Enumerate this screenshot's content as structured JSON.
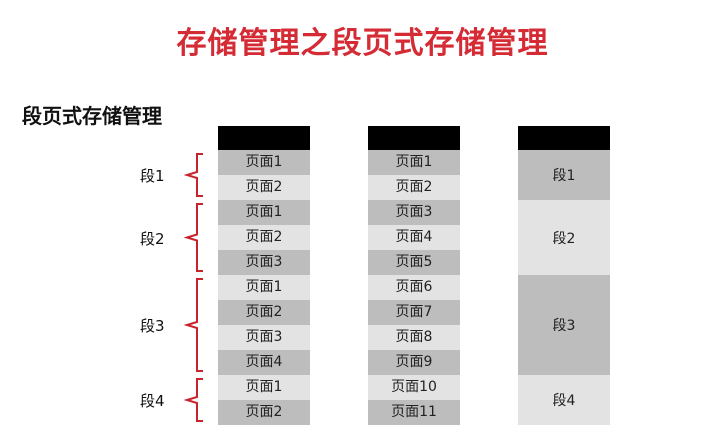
{
  "title": "存储管理之段页式存储管理",
  "subtitle": "段页式存储管理",
  "segments": [
    {
      "label": "段1",
      "pages": [
        "页面1",
        "页面2"
      ]
    },
    {
      "label": "段2",
      "pages": [
        "页面1",
        "页面2",
        "页面3"
      ]
    },
    {
      "label": "段3",
      "pages": [
        "页面1",
        "页面2",
        "页面3",
        "页面4"
      ]
    },
    {
      "label": "段4",
      "pages": [
        "页面1",
        "页面2"
      ]
    }
  ],
  "physical_pages": [
    "页面1",
    "页面2",
    "页面3",
    "页面4",
    "页面5",
    "页面6",
    "页面7",
    "页面8",
    "页面9",
    "页面10",
    "页面11"
  ],
  "segment_column": [
    "段1",
    "段2",
    "段3",
    "段4"
  ],
  "colors": {
    "title": "#d42b35",
    "brace": "#c8232c",
    "header": "#000000",
    "shade_dark": "#bdbdbd",
    "shade_light": "#e3e3e3"
  }
}
